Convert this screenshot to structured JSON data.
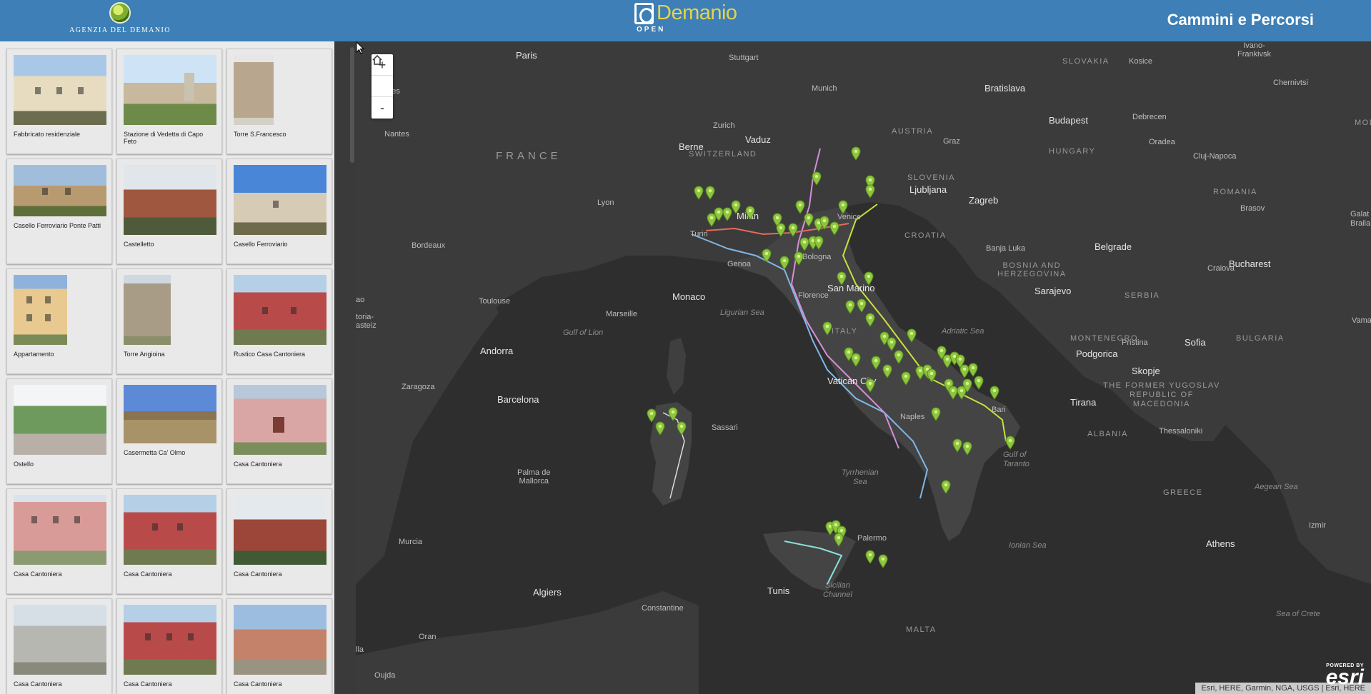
{
  "header": {
    "agency_name": "AGENZIA DEL DEMANIO",
    "logo_text": "Demanio",
    "logo_subtext": "OPEN",
    "title": "Cammini e Percorsi"
  },
  "gallery": [
    {
      "caption": "Fabbricato residenziale"
    },
    {
      "caption": "Stazione di Vedetta di Capo Feto"
    },
    {
      "caption": "Torre S.Francesco"
    },
    {
      "caption": "Casello Ferroviario Ponte Patti"
    },
    {
      "caption": "Castelletto"
    },
    {
      "caption": "Casello Ferroviario"
    },
    {
      "caption": "Appartamento"
    },
    {
      "caption": "Torre Angioina"
    },
    {
      "caption": "Rustico Casa Cantoniera"
    },
    {
      "caption": "Ostello"
    },
    {
      "caption": "Casermetta Ca' Olmo"
    },
    {
      "caption": "Casa Cantoniera"
    },
    {
      "caption": "Casa Cantoniera"
    },
    {
      "caption": "Casa Cantoniera"
    },
    {
      "caption": "Casa Cantoniera"
    },
    {
      "caption": "Casa Cantoniera"
    },
    {
      "caption": "Casa Cantoniera"
    },
    {
      "caption": "Casa Cantoniera"
    }
  ],
  "map": {
    "zoom_in": "+",
    "zoom_out": "-",
    "home_icon": "home-icon",
    "attribution": "Esri, HERE, Garmin, NGA, USGS | Esri, HERE",
    "powered_by": "POWERED BY",
    "esri": "esri",
    "labels": {
      "paris": "Paris",
      "stuttgart": "Stuttgart",
      "munich": "Munich",
      "slovakia": "SLOVAKIA",
      "kosice": "Kosice",
      "ivano": "Ivano-\nFrankivsk",
      "chernivtsi": "Chernivtsi",
      "bratislava": "Bratislava",
      "nantes": "Nantes",
      "zurich": "Zurich",
      "vaduz": "Vaduz",
      "austria": "AUSTRIA",
      "graz": "Graz",
      "budapest": "Budapest",
      "debrecen": "Debrecen",
      "berne": "Berne",
      "switzerland": "SWITZERLAND",
      "oradea": "Oradea",
      "hungary": "HUNGARY",
      "cluj": "Cluj-Napoca",
      "france": "FRANCE",
      "slovenia": "SLOVENIA",
      "ljubljana": "Ljubljana",
      "zagreb": "Zagreb",
      "lyon": "Lyon",
      "romania": "ROMANIA",
      "brasov": "Brasov",
      "galati": "Galat\nBraila",
      "milan": "Milan",
      "venice": "Venice",
      "turin": "Turin",
      "croatia": "CROATIA",
      "bordeaux": "Bordeaux",
      "banjaluka": "Banja Luka",
      "belgrade": "Belgrade",
      "bucharest": "Bucharest",
      "bosnia": "BOSNIA AND\nHERZEGOVINA",
      "genoa": "Genoa",
      "bologna": "Bologna",
      "craiova": "Craiova",
      "sanmarino": "San Marino",
      "sarajevo": "Sarajevo",
      "serbia": "SERBIA",
      "toulouse": "Toulouse",
      "monaco": "Monaco",
      "marseille": "Marseille",
      "ligurian": "Ligurian Sea",
      "florence": "Florence",
      "italy": "ITALY",
      "adriatic": "Adriatic Sea",
      "montenegro": "MONTENEGRO",
      "podgorica": "Podgorica",
      "pristina": "Pristina",
      "sofia": "Sofia",
      "bulgaria": "BULGARIA",
      "gulflion": "Gulf of Lion",
      "andorra": "Andorra",
      "skopje": "Skopje",
      "zaragoza": "Zaragoza",
      "vatican": "Vatican City",
      "yugoslav": "THE FORMER YUGOSLAV\nREPUBLIC OF\nMACEDONIA",
      "barcelona": "Barcelona",
      "tirana": "Tirana",
      "naples": "Naples",
      "bari": "Bari",
      "albania": "ALBANIA",
      "thessaloniki": "Thessaloniki",
      "cassari": "Sassari",
      "gulftaranto": "Gulf of\nTaranto",
      "palma": "Palma de\nMallorca",
      "tyrrhenian": "Tyrrhenian\nSea",
      "greece": "GREECE",
      "aegean": "Aegean Sea",
      "palermo": "Palermo",
      "ionian": "Ionian Sea",
      "murcia": "Murcia",
      "izmir": "Izmir",
      "athens": "Athens",
      "algiers": "Algiers",
      "tunis": "Tunis",
      "sicilian": "Sicilian\nChannel",
      "constantine": "Constantine",
      "malta": "MALTA",
      "oran": "Oran",
      "seacrete": "Sea of Crete",
      "oujda": "Oujda",
      "torria": "toria-\nasteiz",
      "ao": "ao",
      "lla": "lla",
      "nnes": "nnes",
      "vama": "Vama",
      "mol": "MOL"
    }
  }
}
